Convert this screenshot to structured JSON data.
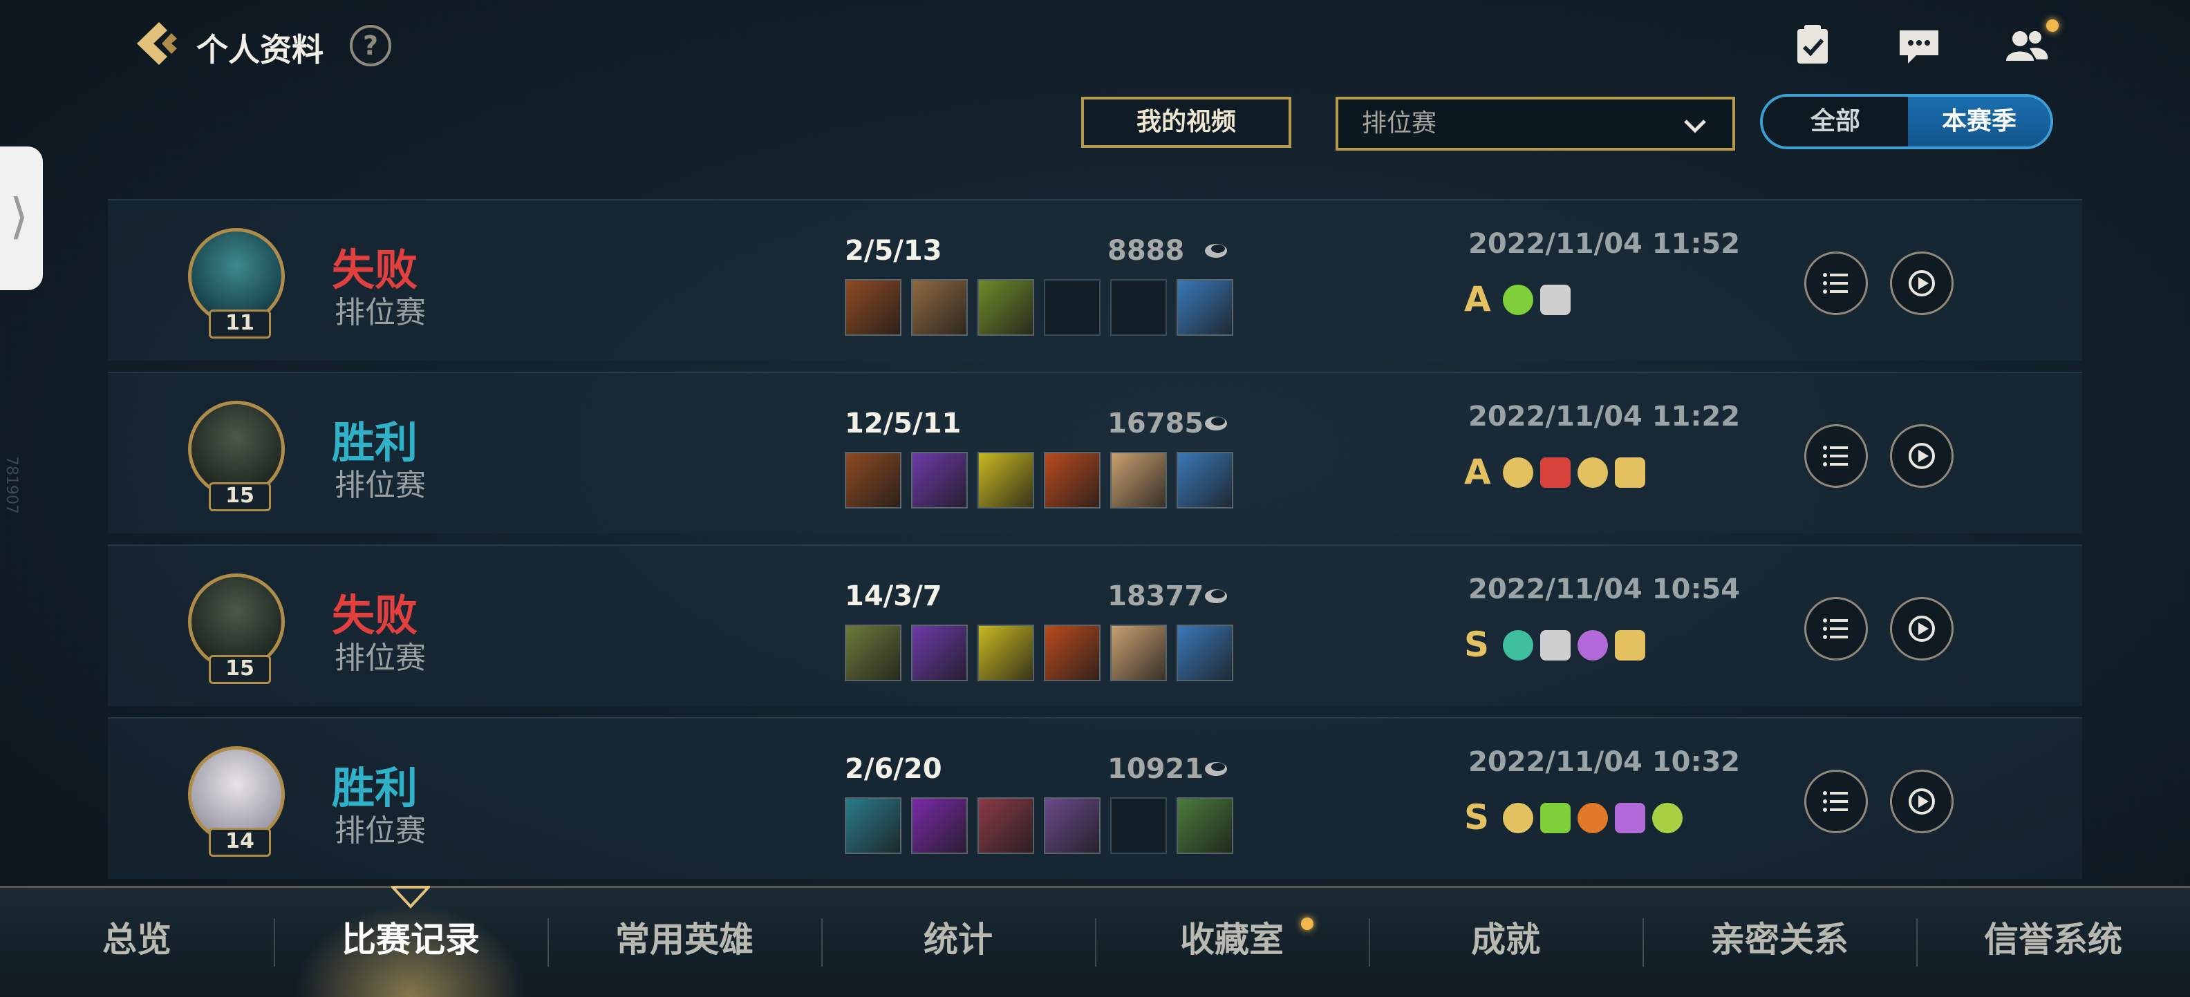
{
  "header": {
    "title": "个人资料",
    "help_label": "?"
  },
  "filters": {
    "video_label": "我的视频",
    "mode_selected": "排位赛",
    "segment": {
      "all_label": "全部",
      "season_label": "本赛季",
      "selected": "本赛季"
    }
  },
  "side_id": "781907",
  "matches": [
    {
      "result": "失败",
      "result_type": "loss",
      "mode": "排位赛",
      "level": "11",
      "kda": "2/5/13",
      "gold": "8888",
      "date": "2022/11/04 11:52",
      "grade": "A",
      "items": [
        "#8e4a22",
        "#8f6a40",
        "#6f8a2a",
        "",
        "",
        "#3a78b8"
      ],
      "medals": [
        "#7fcf3a",
        "#cfcfcf"
      ]
    },
    {
      "result": "胜利",
      "result_type": "win",
      "mode": "排位赛",
      "level": "15",
      "kda": "12/5/11",
      "gold": "16785",
      "date": "2022/11/04 11:22",
      "grade": "A",
      "items": [
        "#8e4a22",
        "#6c3aa8",
        "#c8b820",
        "#b84a1e",
        "#c8a070",
        "#3a78b8"
      ],
      "medals": [
        "#e3c060",
        "#d8443c",
        "#e3c060",
        "#e3c060"
      ]
    },
    {
      "result": "失败",
      "result_type": "loss",
      "mode": "排位赛",
      "level": "15",
      "kda": "14/3/7",
      "gold": "18377",
      "date": "2022/11/04 10:54",
      "grade": "S",
      "items": [
        "#6a7a3a",
        "#6c3aa8",
        "#c8b820",
        "#b84a1e",
        "#c8a070",
        "#3a78b8"
      ],
      "medals": [
        "#3fbfa0",
        "#cfcfcf",
        "#b26ad8",
        "#e3c060"
      ]
    },
    {
      "result": "胜利",
      "result_type": "win",
      "mode": "排位赛",
      "level": "14",
      "kda": "2/6/20",
      "gold": "10921",
      "date": "2022/11/04 10:32",
      "grade": "S",
      "items": [
        "#2a7a8a",
        "#7a2aa8",
        "#8a3a48",
        "#6a4a8a",
        "",
        "#4a7a3a"
      ],
      "medals": [
        "#e3c060",
        "#7fcf3a",
        "#e07a2a",
        "#b26ad8",
        "#a8d040"
      ]
    }
  ],
  "nav": {
    "tabs": [
      "总览",
      "比赛记录",
      "常用英雄",
      "统计",
      "收藏室",
      "成就",
      "亲密关系",
      "信誉系统"
    ],
    "active": "比赛记录"
  },
  "colors": {
    "loss": "#e2403f",
    "win": "#2fb2c8",
    "gold_accent": "#b89a4e",
    "active_blue": "#1a6fb0"
  }
}
